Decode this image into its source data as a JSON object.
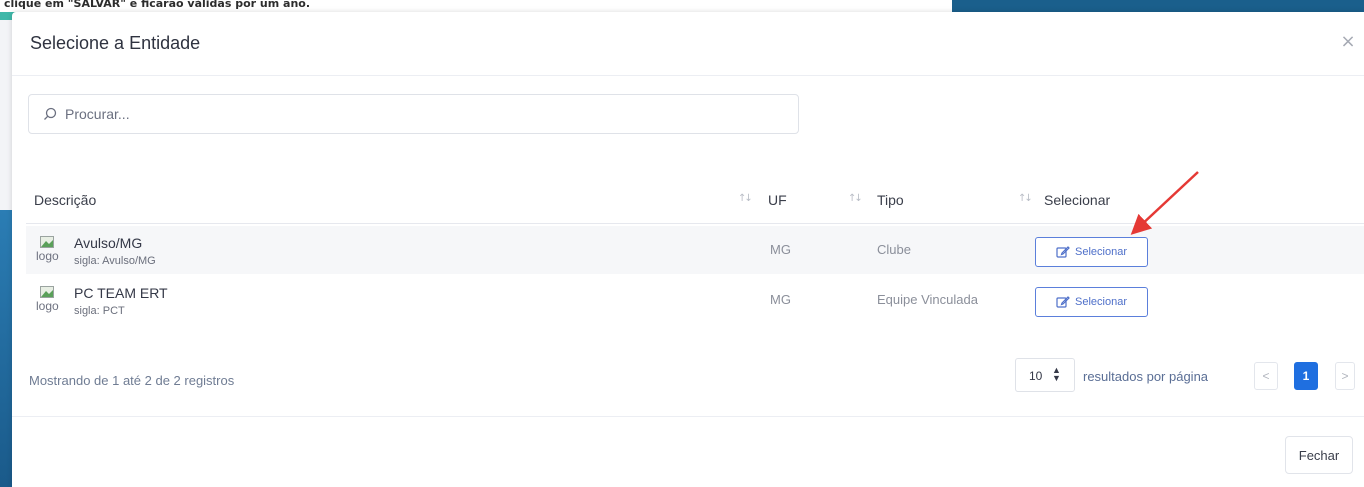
{
  "background": {
    "notice_text": "clique em \"SALVAR\" e ficarão válidas por um ano."
  },
  "modal": {
    "title": "Selecione a Entidade",
    "close_symbol": "×"
  },
  "search": {
    "placeholder": "Procurar..."
  },
  "table": {
    "headers": {
      "descricao": "Descrição",
      "uf": "UF",
      "tipo": "Tipo",
      "selecionar": "Selecionar"
    },
    "rows": [
      {
        "logo_alt": "logo",
        "name": "Avulso/MG",
        "sigla": "sigla: Avulso/MG",
        "uf": "MG",
        "tipo": "Clube",
        "button_label": "Selecionar"
      },
      {
        "logo_alt": "logo",
        "name": "PC TEAM ERT",
        "sigla": "sigla: PCT",
        "uf": "MG",
        "tipo": "Equipe Vinculada",
        "button_label": "Selecionar"
      }
    ]
  },
  "pagination": {
    "summary": "Mostrando de 1 até 2 de 2 registros",
    "per_page_value": "10",
    "per_page_label": "resultados por página",
    "prev": "<",
    "current_page": "1",
    "next": ">"
  },
  "footer": {
    "close_label": "Fechar"
  },
  "colors": {
    "accent": "#1f6fe0",
    "button_border": "#5b7fdb",
    "annotation_arrow": "#e53935",
    "teal_bar": "#3fb8a9",
    "background_blue": "#1a5f8c"
  },
  "icons": {
    "search": "search-icon",
    "edit": "edit-icon",
    "close": "close-icon",
    "sort": "sort-icon",
    "broken_image": "broken-image-icon"
  }
}
